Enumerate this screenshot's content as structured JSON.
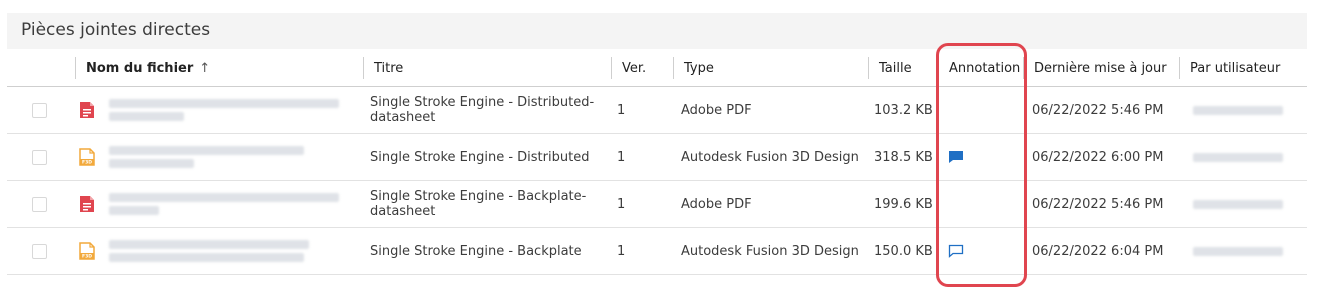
{
  "panel": {
    "title": "Pièces jointes directes"
  },
  "columns": {
    "name": "Nom du fichier",
    "sort_arrow": "↑",
    "title": "Titre",
    "ver": "Ver.",
    "type": "Type",
    "size": "Taille",
    "annotation": "Annotation",
    "date": "Dernière mise à jour",
    "user": "Par utilisateur"
  },
  "rows": [
    {
      "icon": "pdf-file-icon",
      "title": "Single Stroke Engine - Distributed-datasheet",
      "ver": "1",
      "type": "Adobe PDF",
      "size": "103.2 KB",
      "annotation": "none",
      "date": "06/22/2022 5:46 PM"
    },
    {
      "icon": "f3d-file-icon",
      "title": "Single Stroke Engine - Distributed",
      "ver": "1",
      "type": "Autodesk Fusion 3D Design",
      "size": "318.5 KB",
      "annotation": "filled-comment-icon",
      "date": "06/22/2022 6:00 PM"
    },
    {
      "icon": "pdf-file-icon",
      "title": "Single Stroke Engine - Backplate-datasheet",
      "ver": "1",
      "type": "Adobe PDF",
      "size": "199.6 KB",
      "annotation": "none",
      "date": "06/22/2022 5:46 PM"
    },
    {
      "icon": "f3d-file-icon",
      "title": "Single Stroke Engine - Backplate",
      "ver": "1",
      "type": "Autodesk Fusion 3D Design",
      "size": "150.0 KB",
      "annotation": "outline-comment-icon",
      "date": "06/22/2022 6:04 PM"
    }
  ],
  "colors": {
    "pdf": "#e0454f",
    "f3d": "#f2a93b",
    "annotation": "#1f6fc4",
    "highlight": "#e0454f"
  }
}
